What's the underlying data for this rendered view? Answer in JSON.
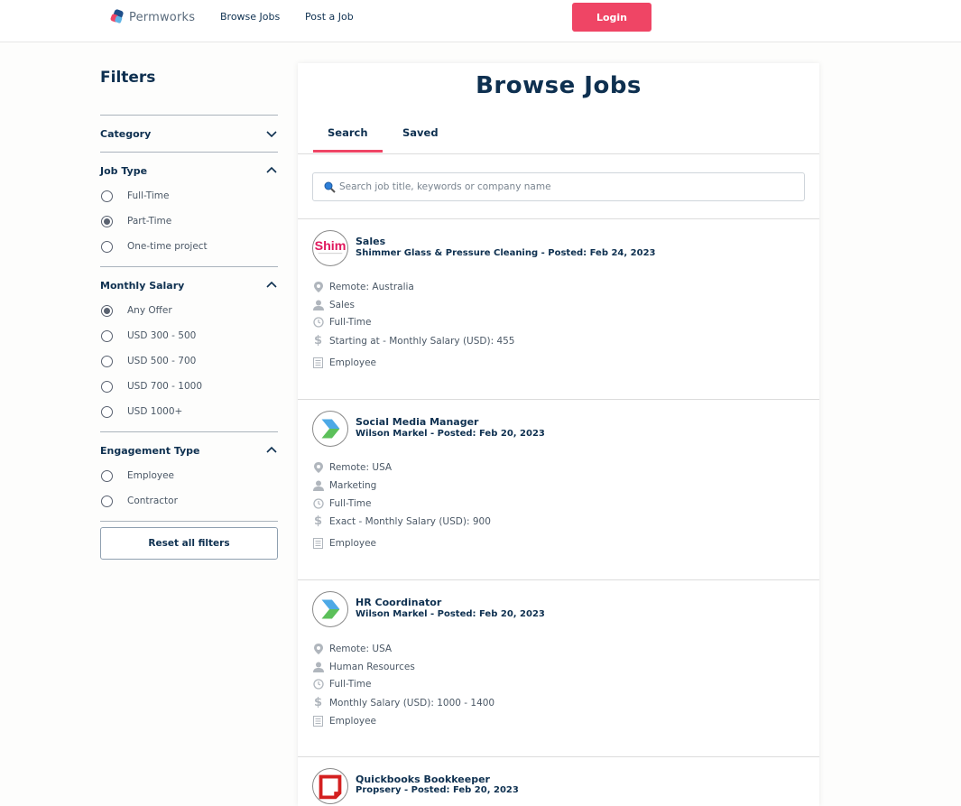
{
  "header": {
    "brand": "Permworks",
    "nav": [
      "Browse Jobs",
      "Post a Job"
    ],
    "login_label": "Login"
  },
  "sidebar": {
    "title": "Filters",
    "sections": [
      {
        "title": "Category",
        "expanded": false,
        "options": []
      },
      {
        "title": "Job Type",
        "expanded": true,
        "options": [
          {
            "label": "Full-Time",
            "checked": false
          },
          {
            "label": "Part-Time",
            "checked": true
          },
          {
            "label": "One-time project",
            "checked": false
          }
        ]
      },
      {
        "title": "Monthly Salary",
        "expanded": true,
        "options": [
          {
            "label": "Any Offer",
            "checked": true
          },
          {
            "label": "USD 300 - 500",
            "checked": false
          },
          {
            "label": "USD 500 - 700",
            "checked": false
          },
          {
            "label": "USD 700 - 1000",
            "checked": false
          },
          {
            "label": "USD 1000+",
            "checked": false
          }
        ]
      },
      {
        "title": "Engagement Type",
        "expanded": true,
        "options": [
          {
            "label": "Employee",
            "checked": false
          },
          {
            "label": "Contractor",
            "checked": false
          }
        ]
      }
    ],
    "reset_label": "Reset all filters"
  },
  "main": {
    "title": "Browse Jobs",
    "tabs": [
      {
        "label": "Search",
        "active": true
      },
      {
        "label": "Saved",
        "active": false
      }
    ],
    "search_placeholder": "Search job title, keywords or company name"
  },
  "jobs": [
    {
      "title": "Sales",
      "company": "Shimmer Glass & Pressure Cleaning",
      "posted": "Posted: Feb 24, 2023",
      "logo": "shimmer",
      "logo_text": "Shim",
      "location": "Remote: Australia",
      "category": "Sales",
      "job_type": "Full-Time",
      "salary": "Starting at - Monthly Salary (USD): 455",
      "engagement": "Employee"
    },
    {
      "title": "Social Media Manager",
      "company": "Wilson Markel",
      "posted": "Posted: Feb 20, 2023",
      "logo": "arrow",
      "location": "Remote: USA",
      "category": "Marketing",
      "job_type": "Full-Time",
      "salary": "Exact - Monthly Salary (USD): 900",
      "engagement": "Employee"
    },
    {
      "title": "HR Coordinator",
      "company": "Wilson Markel",
      "posted": "Posted: Feb 20, 2023",
      "logo": "arrow",
      "location": "Remote: USA",
      "category": "Human Resources",
      "job_type": "Full-Time",
      "salary": "Monthly Salary (USD): 1000 - 1400",
      "engagement": "Employee"
    },
    {
      "title": "Quickbooks Bookkeeper",
      "company": "Propsery",
      "posted": "Posted: Feb 20, 2023",
      "logo": "square",
      "location": "",
      "category": "",
      "job_type": "",
      "salary": "",
      "engagement": ""
    }
  ],
  "colors": {
    "accent": "#ef4565",
    "navy": "#0e3050",
    "muted": "#4b5866"
  }
}
